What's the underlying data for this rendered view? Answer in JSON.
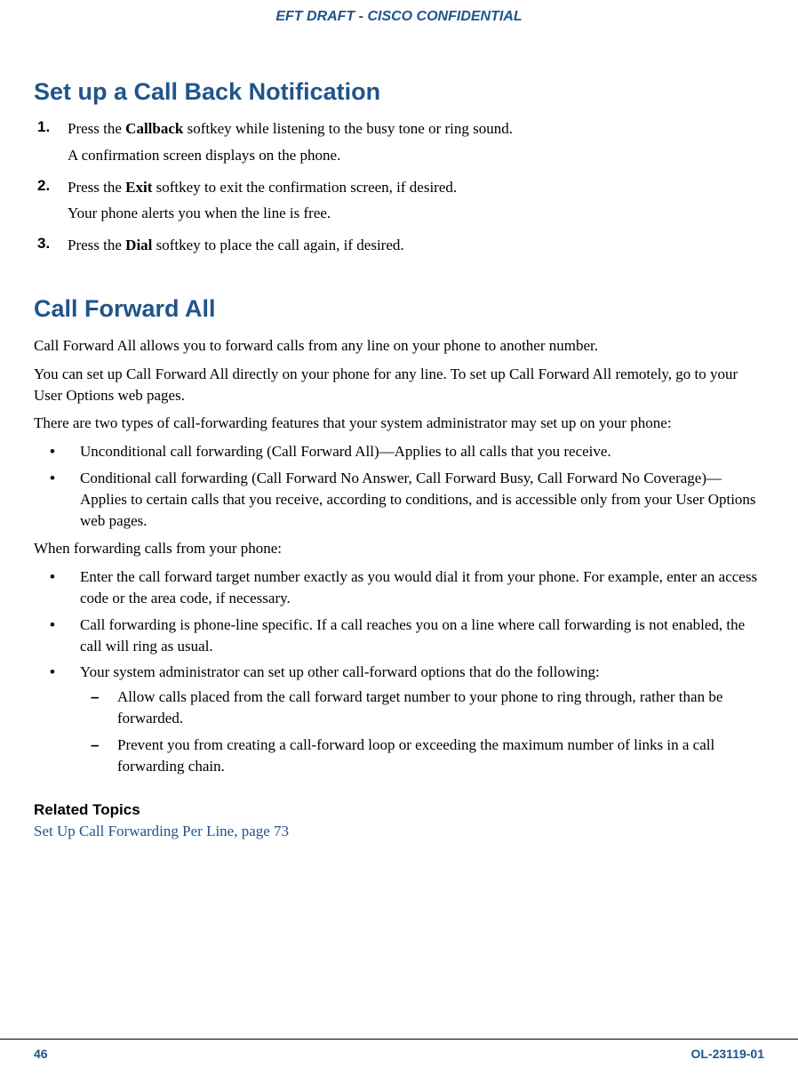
{
  "header": {
    "title": "EFT DRAFT - CISCO CONFIDENTIAL"
  },
  "section1": {
    "title": "Set up a Call Back Notification",
    "steps": [
      {
        "num": "1.",
        "line1_pre": "Press the ",
        "line1_bold": "Callback",
        "line1_post": " softkey while listening to the busy tone or ring sound.",
        "line2": "A confirmation screen displays on the phone."
      },
      {
        "num": "2.",
        "line1_pre": "Press the ",
        "line1_bold": "Exit",
        "line1_post": " softkey to exit the confirmation screen, if desired.",
        "line2": "Your phone alerts you when the line is free."
      },
      {
        "num": "3.",
        "line1_pre": "Press the ",
        "line1_bold": "Dial",
        "line1_post": " softkey to place the call again, if desired.",
        "line2": ""
      }
    ]
  },
  "section2": {
    "title": "Call Forward All",
    "p1": "Call Forward All allows you to forward calls from any line on your phone to another number.",
    "p2": "You can set up Call Forward All directly on your phone for any line. To set up Call Forward All remotely, go to your User Options web pages.",
    "p3": "There are two types of call-forwarding features that your system administrator may set up on your phone:",
    "bullets1": [
      "Unconditional call forwarding (Call Forward All)—Applies to all calls that you receive.",
      "Conditional call forwarding (Call Forward No Answer, Call Forward Busy, Call Forward No Coverage)—Applies to certain calls that you receive, according to conditions, and is accessible only from your User Options web pages."
    ],
    "p4": "When forwarding calls from your phone:",
    "bullets2": [
      {
        "text": "Enter the call forward target number exactly as you would dial it from your phone. For example, enter an access code or the area code, if necessary."
      },
      {
        "text": "Call forwarding is phone-line specific. If a call reaches you on a line where call forwarding is not enabled, the call will ring as usual."
      },
      {
        "text": "Your system administrator can set up other call-forward options that do the following:",
        "sub": [
          "Allow calls placed from the call forward target number to your phone to ring through, rather than be forwarded.",
          "Prevent you from creating a call-forward loop or exceeding the maximum number of links in a call forwarding chain."
        ]
      }
    ],
    "related_heading": "Related Topics",
    "related_link": "Set Up Call Forwarding Per Line, page 73"
  },
  "footer": {
    "page": "46",
    "doc": "OL-23119-01"
  }
}
